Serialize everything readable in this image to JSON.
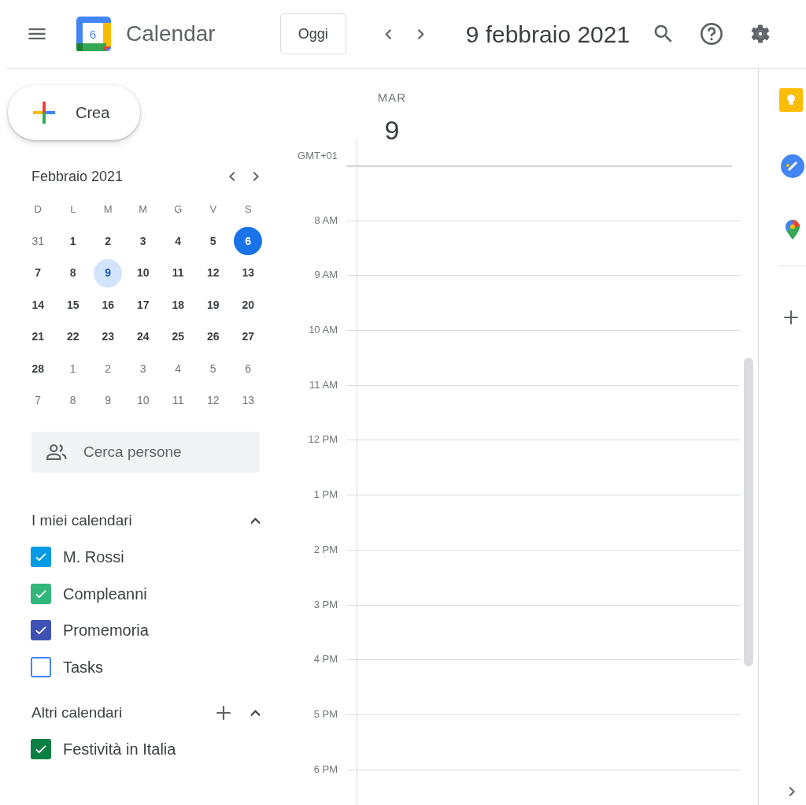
{
  "header": {
    "app_name": "Calendar",
    "logo_day": "6",
    "today_button": "Oggi",
    "date_title": "9 febbraio 2021"
  },
  "create_button": "Crea",
  "mini_calendar": {
    "title": "Febbraio 2021",
    "weekdays": [
      "D",
      "L",
      "M",
      "M",
      "G",
      "V",
      "S"
    ],
    "weeks": [
      [
        {
          "label": "31",
          "other_month": true,
          "selected": false,
          "today": false
        },
        {
          "label": "1",
          "other_month": false,
          "selected": false,
          "today": false
        },
        {
          "label": "2",
          "other_month": false,
          "selected": false,
          "today": false
        },
        {
          "label": "3",
          "other_month": false,
          "selected": false,
          "today": false
        },
        {
          "label": "4",
          "other_month": false,
          "selected": false,
          "today": false
        },
        {
          "label": "5",
          "other_month": false,
          "selected": false,
          "today": false
        },
        {
          "label": "6",
          "other_month": false,
          "selected": false,
          "today": true
        }
      ],
      [
        {
          "label": "7",
          "other_month": false,
          "selected": false,
          "today": false
        },
        {
          "label": "8",
          "other_month": false,
          "selected": false,
          "today": false
        },
        {
          "label": "9",
          "other_month": false,
          "selected": true,
          "today": false
        },
        {
          "label": "10",
          "other_month": false,
          "selected": false,
          "today": false
        },
        {
          "label": "11",
          "other_month": false,
          "selected": false,
          "today": false
        },
        {
          "label": "12",
          "other_month": false,
          "selected": false,
          "today": false
        },
        {
          "label": "13",
          "other_month": false,
          "selected": false,
          "today": false
        }
      ],
      [
        {
          "label": "14",
          "other_month": false,
          "selected": false,
          "today": false
        },
        {
          "label": "15",
          "other_month": false,
          "selected": false,
          "today": false
        },
        {
          "label": "16",
          "other_month": false,
          "selected": false,
          "today": false
        },
        {
          "label": "17",
          "other_month": false,
          "selected": false,
          "today": false
        },
        {
          "label": "18",
          "other_month": false,
          "selected": false,
          "today": false
        },
        {
          "label": "19",
          "other_month": false,
          "selected": false,
          "today": false
        },
        {
          "label": "20",
          "other_month": false,
          "selected": false,
          "today": false
        }
      ],
      [
        {
          "label": "21",
          "other_month": false,
          "selected": false,
          "today": false
        },
        {
          "label": "22",
          "other_month": false,
          "selected": false,
          "today": false
        },
        {
          "label": "23",
          "other_month": false,
          "selected": false,
          "today": false
        },
        {
          "label": "24",
          "other_month": false,
          "selected": false,
          "today": false
        },
        {
          "label": "25",
          "other_month": false,
          "selected": false,
          "today": false
        },
        {
          "label": "26",
          "other_month": false,
          "selected": false,
          "today": false
        },
        {
          "label": "27",
          "other_month": false,
          "selected": false,
          "today": false
        }
      ],
      [
        {
          "label": "28",
          "other_month": false,
          "selected": false,
          "today": false
        },
        {
          "label": "1",
          "other_month": true,
          "selected": false,
          "today": false
        },
        {
          "label": "2",
          "other_month": true,
          "selected": false,
          "today": false
        },
        {
          "label": "3",
          "other_month": true,
          "selected": false,
          "today": false
        },
        {
          "label": "4",
          "other_month": true,
          "selected": false,
          "today": false
        },
        {
          "label": "5",
          "other_month": true,
          "selected": false,
          "today": false
        },
        {
          "label": "6",
          "other_month": true,
          "selected": false,
          "today": false
        }
      ],
      [
        {
          "label": "7",
          "other_month": true,
          "selected": false,
          "today": false
        },
        {
          "label": "8",
          "other_month": true,
          "selected": false,
          "today": false
        },
        {
          "label": "9",
          "other_month": true,
          "selected": false,
          "today": false
        },
        {
          "label": "10",
          "other_month": true,
          "selected": false,
          "today": false
        },
        {
          "label": "11",
          "other_month": true,
          "selected": false,
          "today": false
        },
        {
          "label": "12",
          "other_month": true,
          "selected": false,
          "today": false
        },
        {
          "label": "13",
          "other_month": true,
          "selected": false,
          "today": false
        }
      ]
    ]
  },
  "search_people": {
    "placeholder": "Cerca persone"
  },
  "my_calendars": {
    "title": "I miei calendari",
    "expanded": true,
    "items": [
      {
        "name": "M. Rossi",
        "color": "#039be5",
        "checked": true
      },
      {
        "name": "Compleanni",
        "color": "#33b679",
        "checked": true
      },
      {
        "name": "Promemoria",
        "color": "#3f51b5",
        "checked": true
      },
      {
        "name": "Tasks",
        "color": "#4285f4",
        "checked": false
      }
    ]
  },
  "other_calendars": {
    "title": "Altri calendari",
    "expanded": true,
    "items": [
      {
        "name": "Festività in Italia",
        "color": "#0b8043",
        "checked": true
      }
    ]
  },
  "day_view": {
    "weekday": "MAR",
    "day": "9",
    "timezone": "GMT+01",
    "hours": [
      "8 AM",
      "9 AM",
      "10 AM",
      "11 AM",
      "12 PM",
      "1 PM",
      "2 PM",
      "3 PM",
      "4 PM",
      "5 PM",
      "6 PM"
    ]
  }
}
